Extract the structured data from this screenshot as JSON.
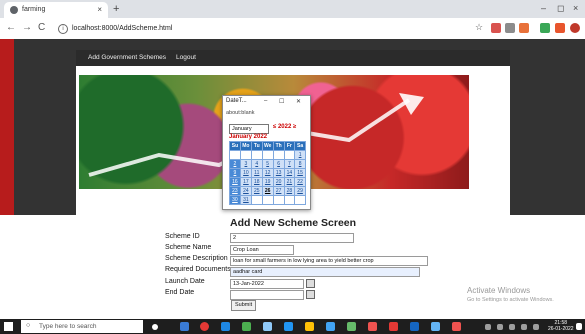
{
  "browser": {
    "tab_title": "farming",
    "tab_close": "×",
    "new_tab": "+",
    "window_controls": {
      "minimize": "–",
      "maximize": "◻",
      "close": "×"
    },
    "nav": {
      "back": "←",
      "forward": "→",
      "reload": "C"
    },
    "url": "localhost:8000/AddScheme.html",
    "info_glyph": "i",
    "star": "☆"
  },
  "navbar": {
    "links": [
      "Add Government Schemes",
      "Logout"
    ]
  },
  "form": {
    "heading": "Add New Scheme Screen",
    "fields": [
      {
        "label": "Scheme ID",
        "value": "2"
      },
      {
        "label": "Scheme Name",
        "value": "Crop Loan"
      },
      {
        "label": "Scheme Description",
        "value": "loan for small farmers in low lying area to yield better crop"
      },
      {
        "label": "Required Documents",
        "value": "aadhar card"
      },
      {
        "label": "Launch Date",
        "value": "13-Jan-2022"
      },
      {
        "label": "End Date",
        "value": ""
      }
    ],
    "submit_label": "Submit"
  },
  "popup": {
    "title": "DateT...",
    "controls": {
      "minimize": "–",
      "maximize": "☐",
      "close": "✕"
    },
    "address": "about:blank",
    "month_select": "January",
    "year_nav": "≤ 2022 ≥",
    "caption": "January 2022",
    "weekdays": [
      "Su",
      "Mo",
      "Tu",
      "We",
      "Th",
      "Fr",
      "Sa"
    ],
    "weeks": [
      [
        "",
        "",
        "",
        "",
        "",
        "",
        "1"
      ],
      [
        "2",
        "3",
        "4",
        "5",
        "6",
        "7",
        "8"
      ],
      [
        "9",
        "10",
        "11",
        "12",
        "13",
        "14",
        "15"
      ],
      [
        "16",
        "17",
        "18",
        "19",
        "20",
        "21",
        "22"
      ],
      [
        "23",
        "24",
        "25",
        "26",
        "27",
        "28",
        "29"
      ],
      [
        "30",
        "31",
        "",
        "",
        "",
        "",
        ""
      ]
    ],
    "today": "26"
  },
  "watermark": {
    "line1": "Activate Windows",
    "line2": "Go to Settings to activate Windows."
  },
  "taskbar": {
    "search_placeholder": "Type here to search",
    "search_icon": "search-icon",
    "time": "21:58",
    "date": "26-01-2022"
  },
  "colors": {
    "page_band": "#333333",
    "navbar": "#2b2b2b",
    "calendar_header": "#2a6fba",
    "calendar_cell": "#cfe0f7",
    "year_red": "#cc0000"
  }
}
